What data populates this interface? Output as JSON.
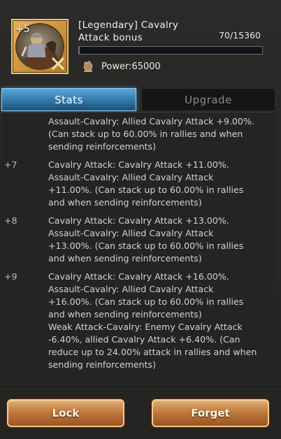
{
  "header": {
    "level_badge": "+5",
    "title": "[Legendary] Cavalry Attack bonus",
    "progress_text": "70/15360",
    "progress_fraction": 0.0046,
    "power_text": "Power:65000"
  },
  "tabs": [
    {
      "label": "Stats",
      "active": true
    },
    {
      "label": "Upgrade",
      "active": false
    }
  ],
  "stats": [
    {
      "level": "",
      "lines": [
        "Assault-Cavalry: Allied Cavalry Attack +9.00%. (Can stack up to 60.00% in rallies and when sending reinforcements)"
      ]
    },
    {
      "level": "+7",
      "lines": [
        "Cavalry Attack: Cavalry Attack +11.00%.",
        "Assault-Cavalry: Allied Cavalry Attack +11.00%. (Can stack up to 60.00% in rallies and when sending reinforcements)"
      ]
    },
    {
      "level": "+8",
      "lines": [
        "Cavalry Attack: Cavalry Attack +13.00%.",
        "Assault-Cavalry: Allied Cavalry Attack +13.00%. (Can stack up to 60.00% in rallies and when sending reinforcements)"
      ]
    },
    {
      "level": "+9",
      "lines": [
        "Cavalry Attack: Cavalry Attack +16.00%.",
        "Assault-Cavalry: Allied Cavalry Attack +16.00%. (Can stack up to 60.00% in rallies and when sending reinforcements)",
        "Weak Attack-Cavalry: Enemy Cavalry Attack -6.40%, allied Cavalry Attack +6.40%. (Can reduce up to 24.00% attack in rallies and when sending reinforcements)"
      ]
    }
  ],
  "buttons": {
    "lock_label": "Lock",
    "forget_label": "Forget"
  },
  "colors": {
    "accent_tab": "#2f78aa",
    "button": "#c07a3e",
    "progress": "#4a87c7"
  }
}
